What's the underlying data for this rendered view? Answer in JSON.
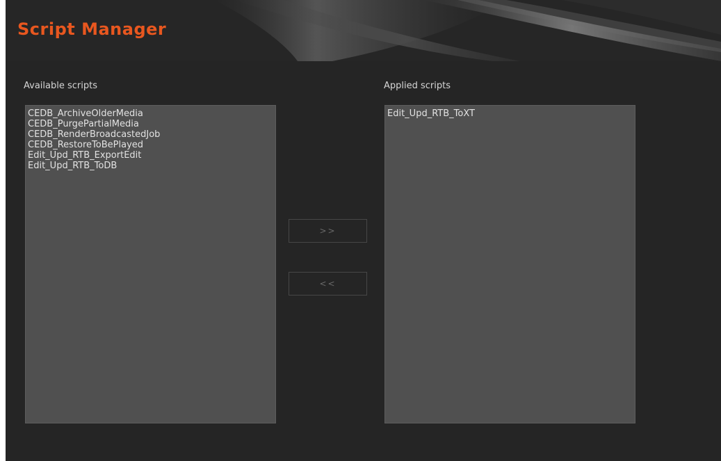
{
  "header": {
    "title": "Script Manager"
  },
  "available": {
    "label": "Available scripts",
    "items": [
      "CEDB_ArchiveOlderMedia",
      "CEDB_PurgePartialMedia",
      "CEDB_RenderBroadcastedJob",
      "CEDB_RestoreToBePlayed",
      "Edit_Upd_RTB_ExportEdit",
      "Edit_Upd_RTB_ToDB"
    ]
  },
  "applied": {
    "label": "Applied scripts",
    "items": [
      "Edit_Upd_RTB_ToXT"
    ]
  },
  "buttons": {
    "add_label": ">>",
    "remove_label": "<<"
  },
  "colors": {
    "title": "#e8571f",
    "background": "#252525",
    "listbox": "#505050",
    "text": "#e2e2e2"
  }
}
